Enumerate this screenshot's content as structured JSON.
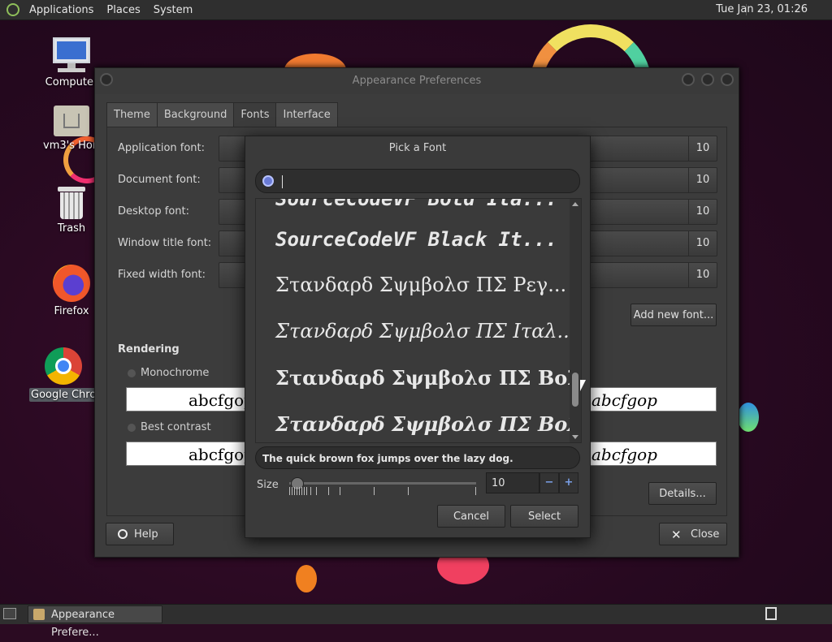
{
  "top_panel": {
    "menus": [
      "Applications",
      "Places",
      "System"
    ],
    "clock": "Tue Jan 23, 01:26"
  },
  "desktop_icons": [
    {
      "label": "Computer",
      "icon": "computer-icon"
    },
    {
      "label": "vm3's Home",
      "icon": "home-folder-icon"
    },
    {
      "label": "Trash",
      "icon": "trash-icon"
    },
    {
      "label": "Firefox",
      "icon": "firefox-icon"
    },
    {
      "label": "Google Chrome",
      "icon": "chrome-icon"
    }
  ],
  "window": {
    "title": "Appearance Preferences",
    "tabs": [
      "Theme",
      "Background",
      "Fonts",
      "Interface"
    ],
    "active_tab": "Fonts",
    "font_rows": [
      {
        "label": "Application font:",
        "size": "10"
      },
      {
        "label": "Document font:",
        "size": "10"
      },
      {
        "label": "Desktop font:",
        "size": "10"
      },
      {
        "label": "Window title font:",
        "size": "10"
      },
      {
        "label": "Fixed width font:",
        "size": "10"
      }
    ],
    "add_font_label": "Add new font...",
    "rendering_title": "Rendering",
    "rendering_options": [
      {
        "label": "Monochrome",
        "preview": "abcfgop"
      },
      {
        "label": "Best contrast",
        "preview": "abcfgop"
      }
    ],
    "right_previews": [
      "abcfgop",
      "abcfgop"
    ],
    "details_label": "Details...",
    "help_label": "Help",
    "close_label": "Close"
  },
  "dialog": {
    "title": "Pick a Font",
    "search_value": "",
    "fonts": [
      "SourceCodeVF Bold Ita...",
      "SourceCodeVF Black It...",
      "Στανδαρδ Σψμβολσ ΠΣ Ρεγ...",
      "Στανδαρδ Σψμβολσ ΠΣ Ιταλ...",
      "Στανδαρδ Σψμβολσ ΠΣ Βολδ",
      "Στανδαρδ Σψμβολσ ΠΣ Βολ..."
    ],
    "sample_text": "The quick brown fox jumps over the lazy dog.",
    "size_label": "Size",
    "size_value": "10",
    "size_fraction": 0.04,
    "cancel_label": "Cancel",
    "select_label": "Select"
  },
  "taskbar": {
    "task_label": "Appearance Prefere..."
  },
  "colors": {
    "accent": "#6a7bd6",
    "panel": "#2f2f2f",
    "window": "#3c3c3c"
  }
}
